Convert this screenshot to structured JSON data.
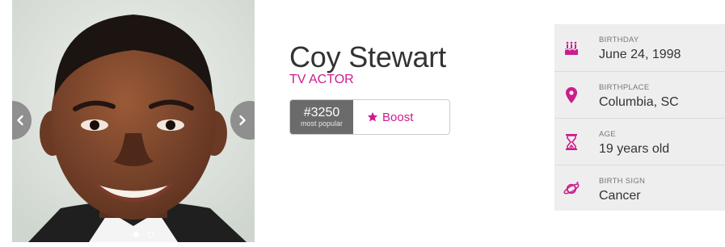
{
  "person": {
    "name": "Coy Stewart",
    "profession": "TV ACTOR"
  },
  "photo": {
    "alt": "Coy Stewart portrait",
    "slides": 2,
    "active_slide": 1
  },
  "ranking": {
    "rank": "#3250",
    "rank_label": "most popular",
    "boost_label": "Boost"
  },
  "facts": [
    {
      "label": "BIRTHDAY",
      "value": "June 24, 1998",
      "icon": "cake-icon"
    },
    {
      "label": "BIRTHPLACE",
      "value": "Columbia, SC",
      "icon": "map-pin-icon"
    },
    {
      "label": "AGE",
      "value": "19 years old",
      "icon": "hourglass-icon"
    },
    {
      "label": "BIRTH SIGN",
      "value": "Cancer",
      "icon": "planet-icon"
    }
  ],
  "colors": {
    "accent": "#cc1d8c",
    "panel": "#eeeeee",
    "rank_bg": "#6b6b6b"
  }
}
